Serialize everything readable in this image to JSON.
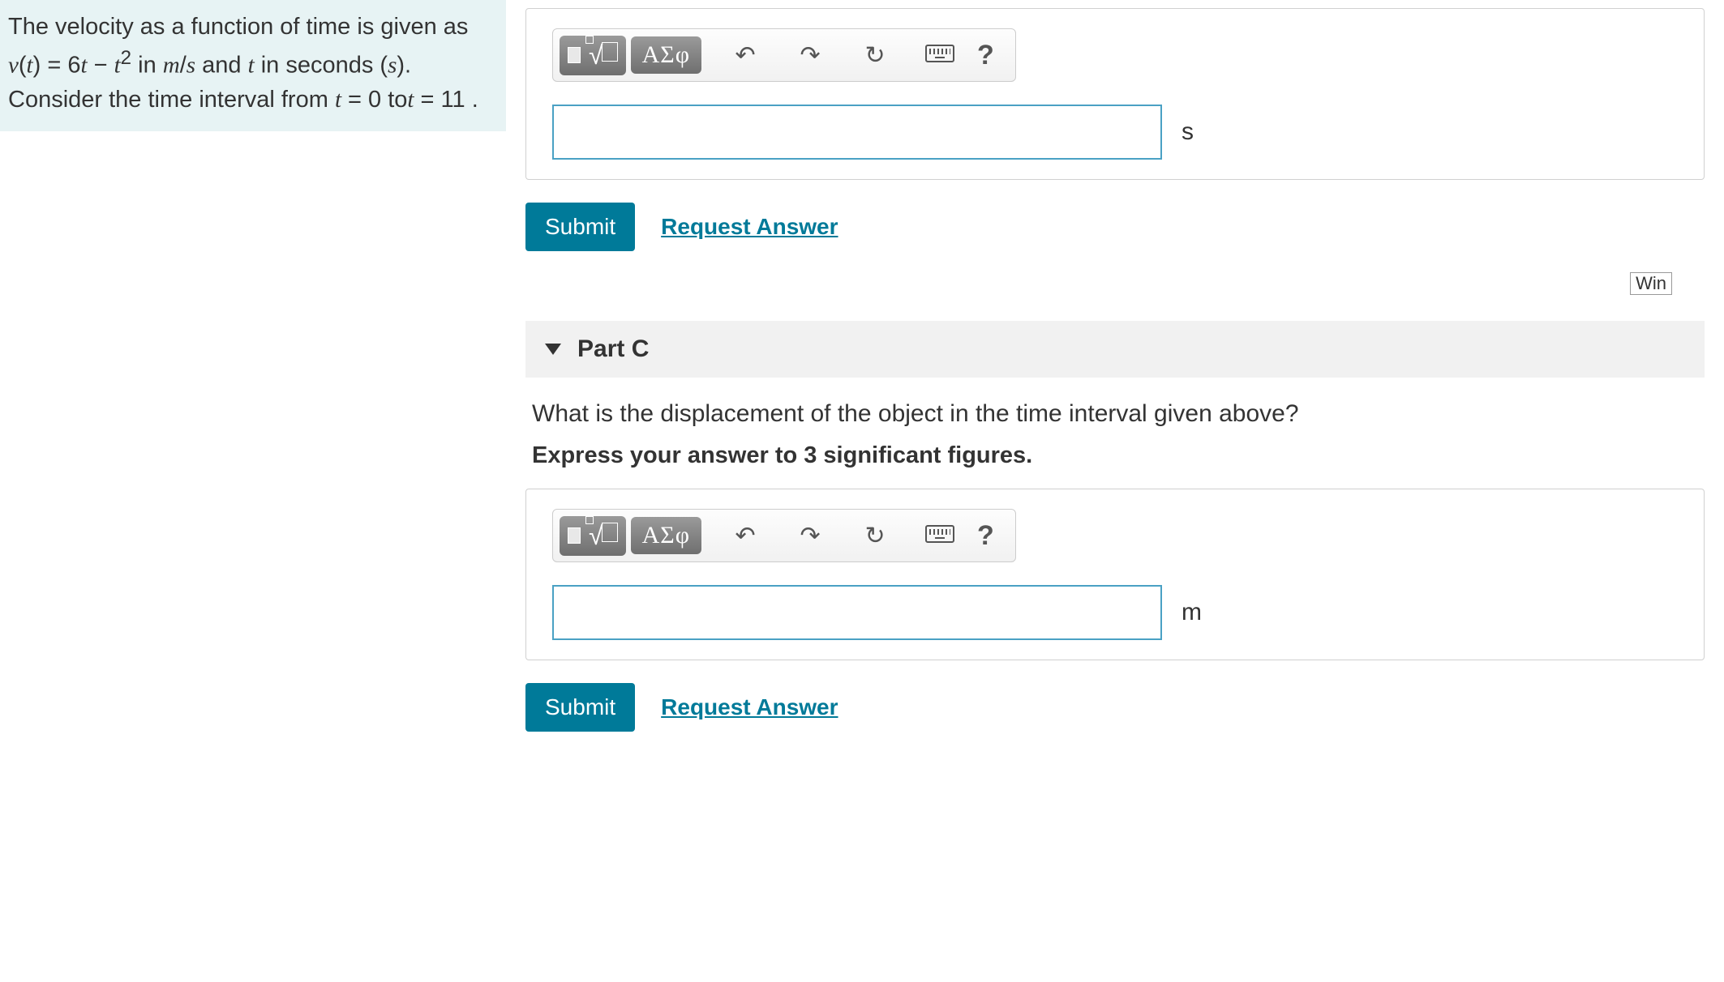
{
  "problem": {
    "html": "The velocity as a function of time is given as <span class='math'>v</span>(<span class='math'>t</span>) = 6<span class='math'>t</span> − <span class='math'>t</span><sup>2</sup> in <span class='math'>m</span>/<span class='math'>s</span> and <span class='math'>t</span> in seconds (<span class='math'>s</span>). Consider the time interval from <span class='math'>t</span> = 0 to<span class='math'>t</span> = 11 ."
  },
  "entryB": {
    "toolbar": {
      "greek_label": "ΑΣφ"
    },
    "unit": "s",
    "submit_label": "Submit",
    "request_label": "Request Answer",
    "input_value": "",
    "win_label": "Win"
  },
  "partC": {
    "header": "Part C",
    "question": "What is the displacement of the object in the time interval given above?",
    "instruction": "Express your answer to 3 significant figures.",
    "toolbar": {
      "greek_label": "ΑΣφ"
    },
    "unit": "m",
    "submit_label": "Submit",
    "request_label": "Request Answer",
    "input_value": ""
  }
}
